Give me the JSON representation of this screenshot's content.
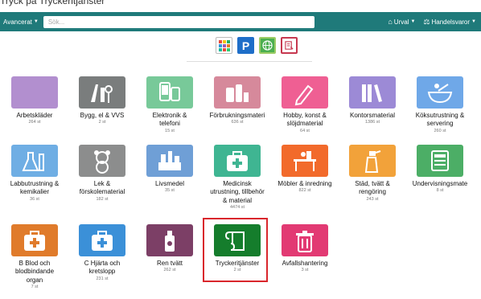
{
  "caption": "Tryck på Tryckeritjänster",
  "navbar": {
    "advanced_label": "Avancerat",
    "search_placeholder": "Sök...",
    "urval_label": "Urval",
    "handelsvaror_label": "Handelsvaror"
  },
  "app_icons": [
    "grid-app-icon",
    "parking-app-icon",
    "globe-app-icon",
    "document-app-icon"
  ],
  "categories": [
    {
      "name": "Arbetskläder",
      "count": "264 st",
      "color": "#b28fcf",
      "icon": "clothing-icon"
    },
    {
      "name": "Bygg, el & VVS",
      "count": "2 st",
      "color": "#7a7d7d",
      "icon": "tools-icon"
    },
    {
      "name": "Elektronik & telefoni",
      "count": "15 st",
      "color": "#78c999",
      "icon": "phone-icon"
    },
    {
      "name": "Förbrukningsmateri",
      "count": "636 st",
      "color": "#d6899b",
      "icon": "consumables-icon"
    },
    {
      "name": "Hobby, konst & slöjdmaterial",
      "count": "64 st",
      "color": "#ef5f93",
      "icon": "pencil-icon"
    },
    {
      "name": "Kontorsmaterial",
      "count": "1386 st",
      "color": "#9c8ad6",
      "icon": "binders-icon"
    },
    {
      "name": "Köksutrustning & servering",
      "count": "260 st",
      "color": "#6fa8e8",
      "icon": "bowl-icon"
    },
    {
      "name": "Labbutrustning & kemikalier",
      "count": "36 st",
      "color": "#6faee4",
      "icon": "lab-flask-icon"
    },
    {
      "name": "Lek & förskolematerial",
      "count": "182 st",
      "color": "#8c8d8d",
      "icon": "teddy-bear-icon"
    },
    {
      "name": "Livsmedel",
      "count": "35 st",
      "color": "#6f9fd6",
      "icon": "food-icon"
    },
    {
      "name": "Medicinsk utrustning, tillbehör & material",
      "count": "4474 st",
      "color": "#3fb592",
      "icon": "first-aid-icon"
    },
    {
      "name": "Möbler & inredning",
      "count": "822 st",
      "color": "#f26a2b",
      "icon": "furniture-icon"
    },
    {
      "name": "Städ, tvätt & rengöring",
      "count": "243 st",
      "color": "#f2a23a",
      "icon": "spray-bottle-icon"
    },
    {
      "name": "Undervisningsmate",
      "count": "8 st",
      "color": "#4cae66",
      "icon": "whiteboard-icon"
    },
    {
      "name": "B Blod och blodbindande organ",
      "count": "7 st",
      "color": "#e07b2b",
      "icon": "first-aid-icon"
    },
    {
      "name": "C Hjärta och kretslopp",
      "count": "231 st",
      "color": "#3b90d8",
      "icon": "first-aid-icon"
    },
    {
      "name": "Ren tvätt",
      "count": "262 st",
      "color": "#7c3f66",
      "icon": "detergent-icon"
    },
    {
      "name": "Tryckeritjänster",
      "count": "2 st",
      "color": "#157d2c",
      "icon": "scroll-icon"
    },
    {
      "name": "Avfallshantering",
      "count": "3 st",
      "color": "#e23a73",
      "icon": "trash-icon"
    }
  ]
}
